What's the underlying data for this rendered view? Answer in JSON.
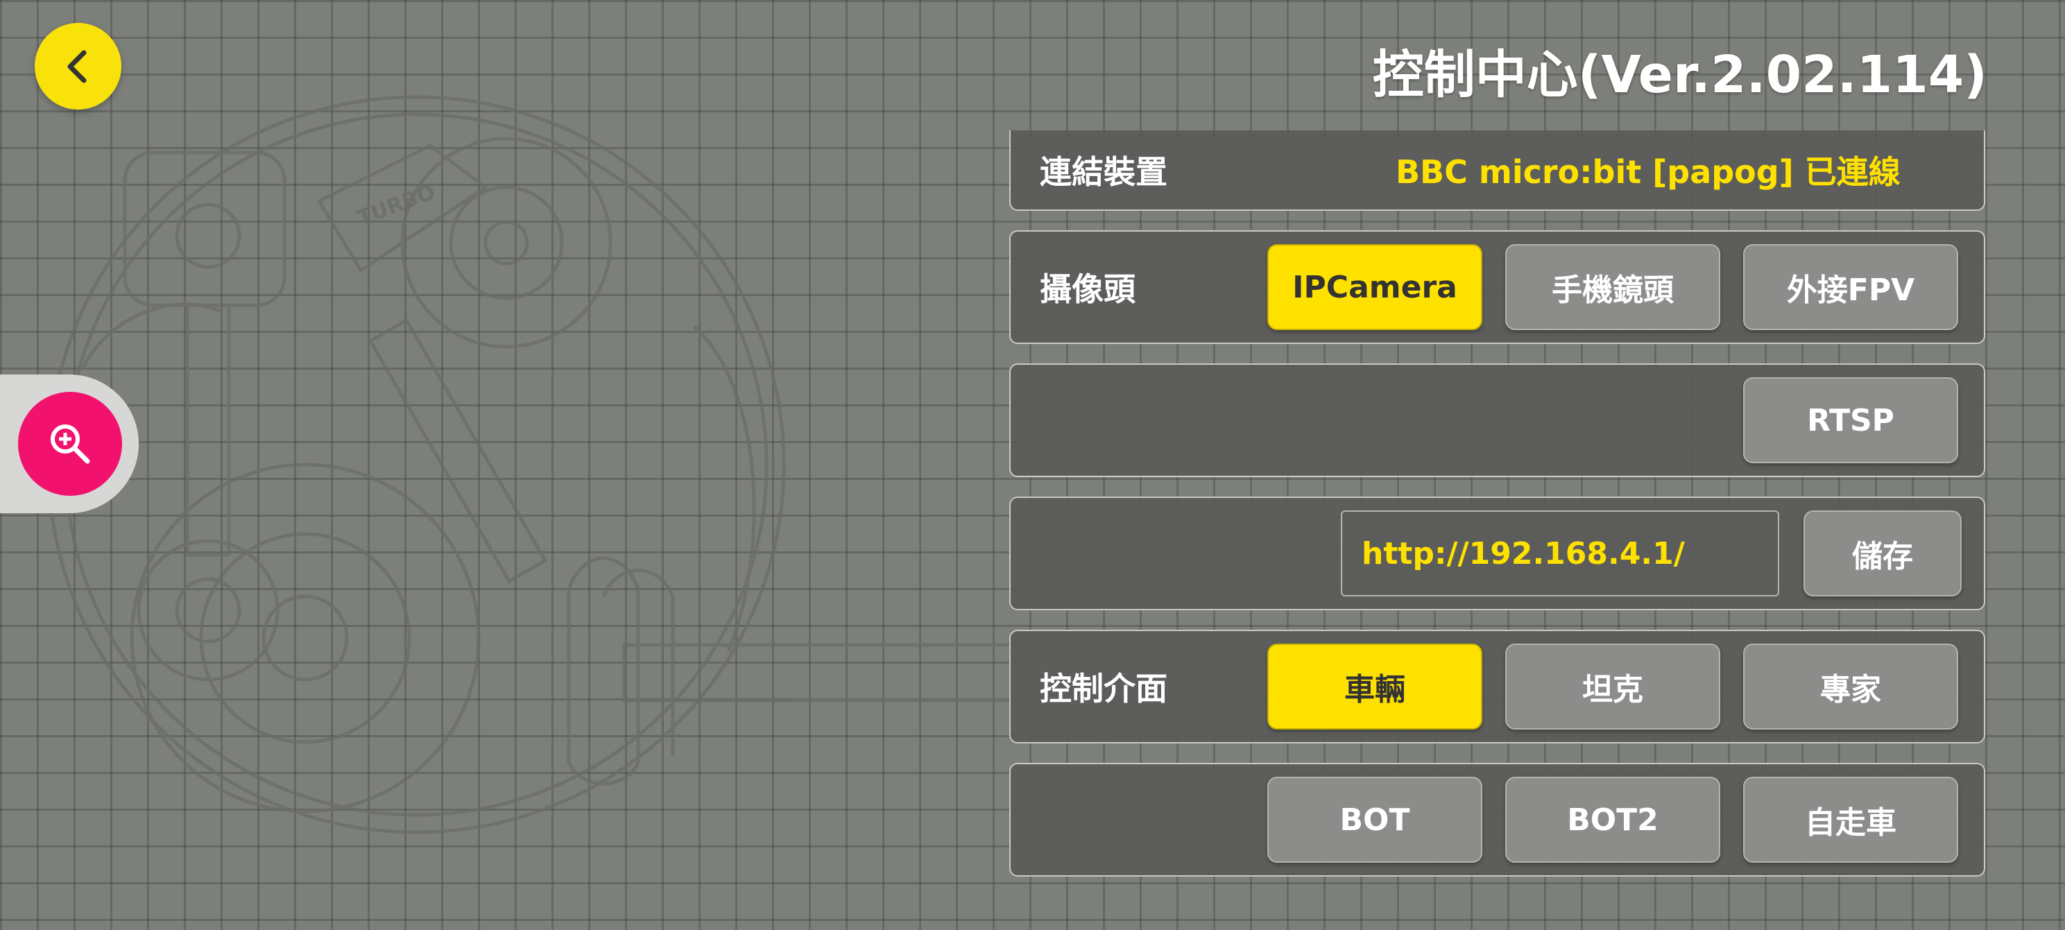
{
  "header": {
    "title": "控制中心(Ver.2.02.114)"
  },
  "icons": {
    "back": "chevron-left-icon",
    "zoom": "zoom-in-icon"
  },
  "colors": {
    "accent": "#ffe100",
    "zoom": "#f2126e",
    "background": "#7d7f7a"
  },
  "device": {
    "label": "連結裝置",
    "status": "BBC micro:bit [papog] 已連線"
  },
  "camera": {
    "label": "攝像頭",
    "options": [
      "IPCamera",
      "手機鏡頭",
      "外接FPV"
    ],
    "selected": "IPCamera"
  },
  "stream": {
    "protocol": "RTSP"
  },
  "url": {
    "value": "http://192.168.4.1/",
    "save_label": "儲存"
  },
  "control": {
    "label": "控制介面",
    "options": [
      "車輛",
      "坦克",
      "專家"
    ],
    "selected": "車輛",
    "extra_options": [
      "BOT",
      "BOT2",
      "自走車"
    ]
  },
  "illustration": {
    "badge": "TURBO"
  }
}
